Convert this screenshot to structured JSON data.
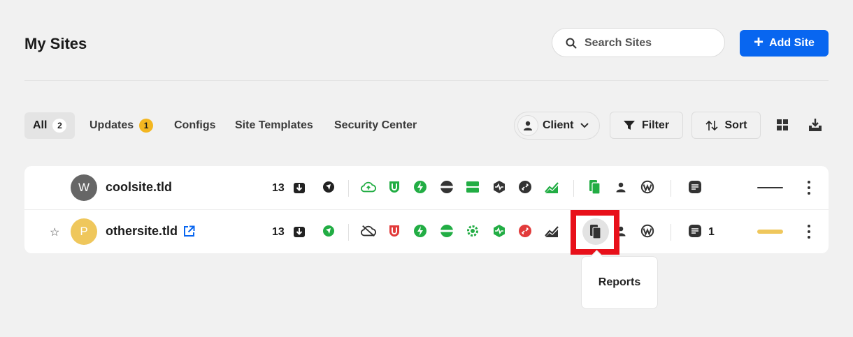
{
  "page": {
    "title": "My Sites"
  },
  "search": {
    "placeholder": "Search Sites"
  },
  "add_site": {
    "label": "Add Site"
  },
  "tabs": [
    {
      "label": "All",
      "count": "2",
      "active": true
    },
    {
      "label": "Updates",
      "count": "1"
    },
    {
      "label": "Configs"
    },
    {
      "label": "Site Templates"
    },
    {
      "label": "Security Center"
    }
  ],
  "toolbar": {
    "client_label": "Client",
    "filter_label": "Filter",
    "sort_label": "Sort"
  },
  "sites": [
    {
      "initial": "W",
      "avatar_color": "#666666",
      "name": "coolsite.tld",
      "updates": "13",
      "notes_count": "",
      "favorite": false,
      "external_link": false,
      "status_bar_color": "#333333"
    },
    {
      "initial": "P",
      "avatar_color": "#efc75c",
      "name": "othersite.tld",
      "updates": "13",
      "notes_count": "1",
      "favorite": true,
      "external_link": true,
      "status_bar_color": "#efc75c"
    }
  ],
  "tooltip": {
    "text": "Reports"
  },
  "colors": {
    "accent": "#0866f0",
    "green": "#22ad44",
    "red": "#e23b3b",
    "highlight": "#e8101a"
  }
}
